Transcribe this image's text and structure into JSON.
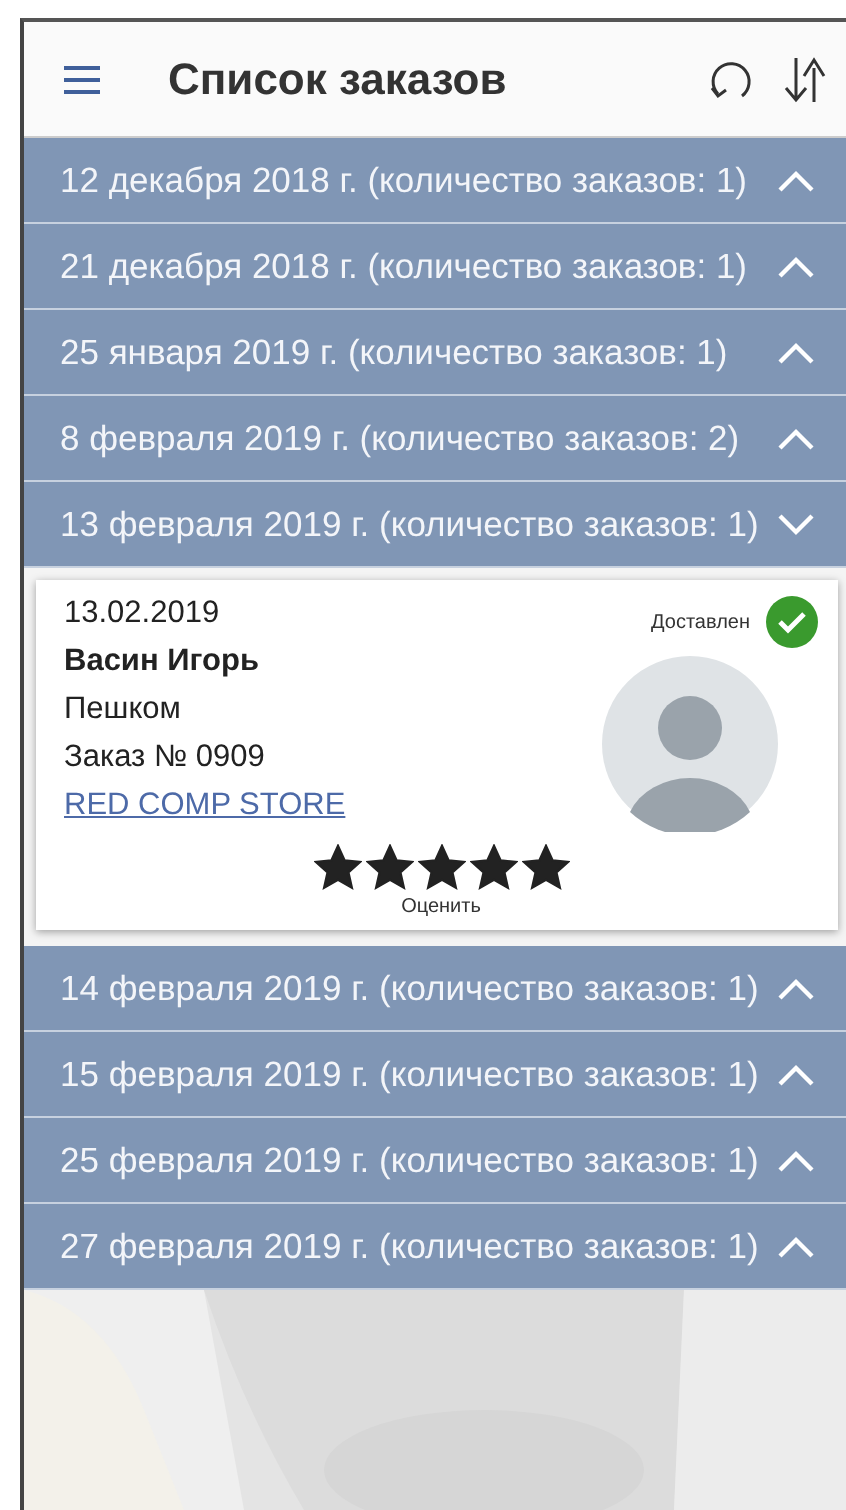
{
  "header": {
    "title": "Список заказов"
  },
  "groups": [
    {
      "label": "12 декабря 2018 г. (количество заказов: 1)",
      "expanded": false
    },
    {
      "label": "21 декабря 2018 г. (количество заказов: 1)",
      "expanded": false
    },
    {
      "label": "25 января 2019 г. (количество заказов: 1)",
      "expanded": false
    },
    {
      "label": "8 февраля 2019 г. (количество заказов: 2)",
      "expanded": false
    },
    {
      "label": "13 февраля 2019 г. (количество заказов: 1)",
      "expanded": true,
      "orders": [
        {
          "date": "13.02.2019",
          "status": "Доставлен",
          "delivered": true,
          "customer": "Васин Игорь",
          "delivery": "Пешком",
          "number": "Заказ № 0909",
          "store": "RED COMP STORE",
          "stars": 5,
          "rate_label": "Оценить"
        }
      ]
    },
    {
      "label": "14 февраля 2019 г. (количество заказов: 1)",
      "expanded": false
    },
    {
      "label": "15 февраля 2019 г. (количество заказов: 1)",
      "expanded": false
    },
    {
      "label": "25 февраля 2019 г. (количество заказов: 1)",
      "expanded": false
    },
    {
      "label": "27 февраля 2019 г. (количество заказов: 1)",
      "expanded": false
    }
  ]
}
